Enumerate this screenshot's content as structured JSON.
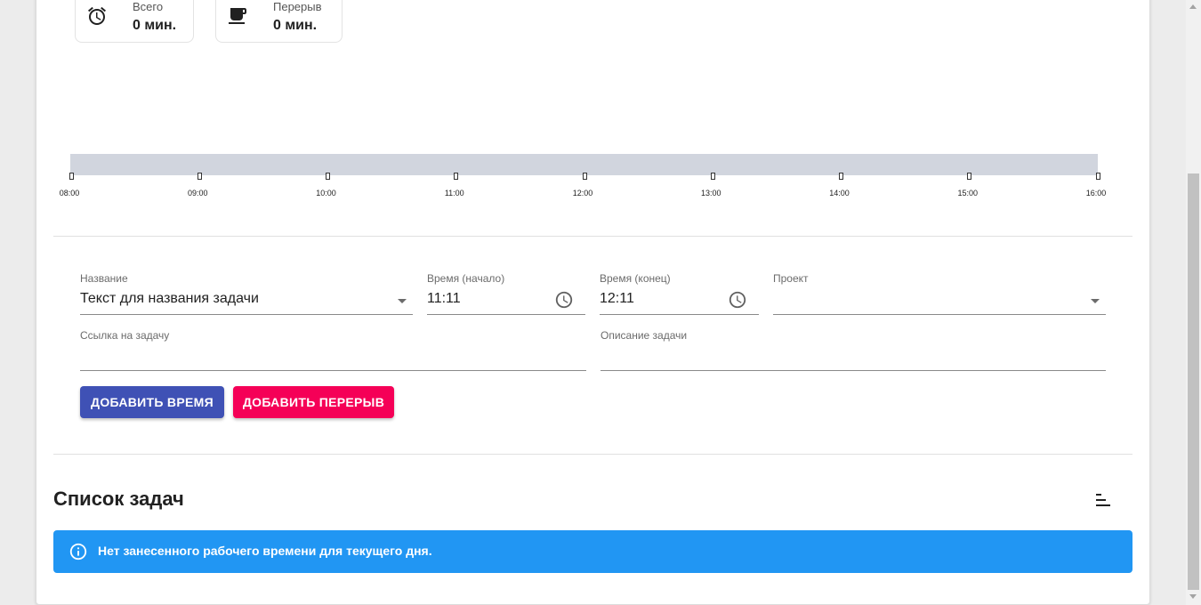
{
  "stats": {
    "total": {
      "label": "Всего",
      "value": "0 мин.",
      "icon": "alarm-clock-icon"
    },
    "break": {
      "label": "Перерыв",
      "value": "0 мин.",
      "icon": "coffee-cup-icon"
    }
  },
  "timeline": {
    "hours": [
      "08:00",
      "09:00",
      "10:00",
      "11:00",
      "12:00",
      "13:00",
      "14:00",
      "15:00",
      "16:00"
    ]
  },
  "form": {
    "name": {
      "label": "Название",
      "value": "Текст для названия задачи"
    },
    "start": {
      "label": "Время (начало)",
      "value": "11:11"
    },
    "end": {
      "label": "Время (конец)",
      "value": "12:11"
    },
    "project": {
      "label": "Проект",
      "value": ""
    },
    "link": {
      "label": "Ссылка на задачу",
      "value": ""
    },
    "description": {
      "label": "Описание задачи",
      "value": ""
    }
  },
  "buttons": {
    "add_time": "ДОБАВИТЬ ВРЕМЯ",
    "add_break": "ДОБАВИТЬ ПЕРЕРЫВ"
  },
  "tasks": {
    "title": "Список задач",
    "empty_message": "Нет занесенного рабочего времени для текущего дня."
  },
  "colors": {
    "primary": "#3f51b5",
    "secondary": "#f50057",
    "info": "#2196f3",
    "timeline_bar": "#d1d5de"
  }
}
